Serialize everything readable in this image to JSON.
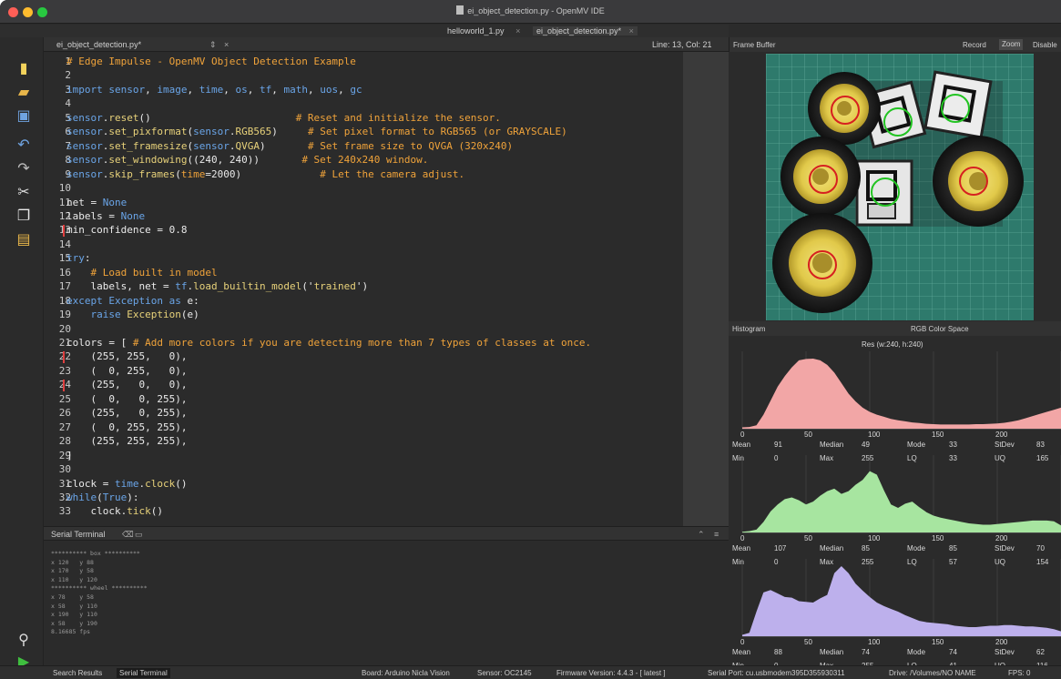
{
  "window": {
    "title": "ei_object_detection.py - OpenMV IDE"
  },
  "tabs": [
    {
      "label": "helloworld_1.py"
    },
    {
      "label": "ei_object_detection.py*"
    }
  ],
  "editor": {
    "file": "ei_object_detection.py*",
    "position": "Line: 13, Col: 21",
    "lines": [
      {
        "n": "1",
        "segs": [
          [
            "c",
            "# Edge Impulse - OpenMV Object Detection Example"
          ]
        ]
      },
      {
        "n": "2",
        "segs": []
      },
      {
        "n": "3",
        "segs": [
          [
            "k",
            "import "
          ],
          [
            "f",
            "sensor"
          ],
          [
            "n",
            ", "
          ],
          [
            "f",
            "image"
          ],
          [
            "n",
            ", "
          ],
          [
            "f",
            "time"
          ],
          [
            "n",
            ", "
          ],
          [
            "f",
            "os"
          ],
          [
            "n",
            ", "
          ],
          [
            "f",
            "tf"
          ],
          [
            "n",
            ", "
          ],
          [
            "f",
            "math"
          ],
          [
            "n",
            ", "
          ],
          [
            "f",
            "uos"
          ],
          [
            "n",
            ", "
          ],
          [
            "f",
            "gc"
          ]
        ]
      },
      {
        "n": "4",
        "segs": []
      },
      {
        "n": "5",
        "segs": [
          [
            "f",
            "sensor"
          ],
          [
            "n",
            "."
          ],
          [
            "s",
            "reset"
          ],
          [
            "n",
            "()                        "
          ],
          [
            "c",
            "# Reset and initialize the sensor."
          ]
        ]
      },
      {
        "n": "6",
        "segs": [
          [
            "f",
            "sensor"
          ],
          [
            "n",
            "."
          ],
          [
            "s",
            "set_pixformat"
          ],
          [
            "n",
            "("
          ],
          [
            "f",
            "sensor"
          ],
          [
            "n",
            "."
          ],
          [
            "s",
            "RGB565"
          ],
          [
            "n",
            ")     "
          ],
          [
            "c",
            "# Set pixel format to RGB565 (or GRAYSCALE)"
          ]
        ]
      },
      {
        "n": "7",
        "segs": [
          [
            "f",
            "sensor"
          ],
          [
            "n",
            "."
          ],
          [
            "s",
            "set_framesize"
          ],
          [
            "n",
            "("
          ],
          [
            "f",
            "sensor"
          ],
          [
            "n",
            "."
          ],
          [
            "s",
            "QVGA"
          ],
          [
            "n",
            ")       "
          ],
          [
            "c",
            "# Set frame size to QVGA (320x240)"
          ]
        ]
      },
      {
        "n": "8",
        "segs": [
          [
            "f",
            "sensor"
          ],
          [
            "n",
            "."
          ],
          [
            "s",
            "set_windowing"
          ],
          [
            "n",
            "((240, 240))       "
          ],
          [
            "c",
            "# Set 240x240 window."
          ]
        ]
      },
      {
        "n": "9",
        "segs": [
          [
            "f",
            "sensor"
          ],
          [
            "n",
            "."
          ],
          [
            "s",
            "skip_frames"
          ],
          [
            "n",
            "("
          ],
          [
            "m",
            "time"
          ],
          [
            "n",
            "=2000)             "
          ],
          [
            "c",
            "# Let the camera adjust."
          ]
        ]
      },
      {
        "n": "10",
        "segs": []
      },
      {
        "n": "11",
        "segs": [
          [
            "n",
            "net = "
          ],
          [
            "k",
            "None"
          ]
        ]
      },
      {
        "n": "12",
        "segs": [
          [
            "n",
            "labels = "
          ],
          [
            "k",
            "None"
          ]
        ]
      },
      {
        "n": "13",
        "segs": [
          [
            "n",
            "min_confidence = 0.8"
          ]
        ]
      },
      {
        "n": "14",
        "segs": []
      },
      {
        "n": "15",
        "segs": [
          [
            "k",
            "try"
          ],
          [
            "n",
            ":"
          ]
        ]
      },
      {
        "n": "16",
        "segs": [
          [
            "n",
            "    "
          ],
          [
            "c",
            "# Load built in model"
          ]
        ]
      },
      {
        "n": "17",
        "segs": [
          [
            "n",
            "    labels, net = "
          ],
          [
            "f",
            "tf"
          ],
          [
            "n",
            "."
          ],
          [
            "s",
            "load_builtin_model"
          ],
          [
            "n",
            "('"
          ],
          [
            "s",
            "trained"
          ],
          [
            "n",
            "')"
          ]
        ]
      },
      {
        "n": "18",
        "segs": [
          [
            "k",
            "except "
          ],
          [
            "f",
            "Exception "
          ],
          [
            "k",
            "as "
          ],
          [
            "n",
            "e:"
          ]
        ]
      },
      {
        "n": "19",
        "segs": [
          [
            "n",
            "    "
          ],
          [
            "k",
            "raise "
          ],
          [
            "s",
            "Exception"
          ],
          [
            "n",
            "(e)"
          ]
        ]
      },
      {
        "n": "20",
        "segs": []
      },
      {
        "n": "21",
        "segs": [
          [
            "n",
            "colors = [ "
          ],
          [
            "c",
            "# Add more colors if you are detecting more than 7 types of classes at once."
          ]
        ]
      },
      {
        "n": "22",
        "segs": [
          [
            "n",
            "    (255, 255,   0),"
          ]
        ]
      },
      {
        "n": "23",
        "segs": [
          [
            "n",
            "    (  0, 255,   0),"
          ]
        ]
      },
      {
        "n": "24",
        "segs": [
          [
            "n",
            "    (255,   0,   0),"
          ]
        ]
      },
      {
        "n": "25",
        "segs": [
          [
            "n",
            "    (  0,   0, 255),"
          ]
        ]
      },
      {
        "n": "26",
        "segs": [
          [
            "n",
            "    (255,   0, 255),"
          ]
        ]
      },
      {
        "n": "27",
        "segs": [
          [
            "n",
            "    (  0, 255, 255),"
          ]
        ]
      },
      {
        "n": "28",
        "segs": [
          [
            "n",
            "    (255, 255, 255),"
          ]
        ]
      },
      {
        "n": "29",
        "segs": [
          [
            "n",
            "]"
          ]
        ]
      },
      {
        "n": "30",
        "segs": []
      },
      {
        "n": "31",
        "segs": [
          [
            "n",
            "clock = "
          ],
          [
            "f",
            "time"
          ],
          [
            "n",
            "."
          ],
          [
            "s",
            "clock"
          ],
          [
            "n",
            "()"
          ]
        ]
      },
      {
        "n": "32",
        "segs": [
          [
            "k",
            "while"
          ],
          [
            "n",
            "("
          ],
          [
            "k",
            "True"
          ],
          [
            "n",
            "):"
          ]
        ]
      },
      {
        "n": "33",
        "segs": [
          [
            "n",
            "    clock."
          ],
          [
            "s",
            "tick"
          ],
          [
            "n",
            "()"
          ]
        ]
      }
    ]
  },
  "terminal": {
    "tab_serial": "Serial Terminal",
    "lines": [
      "********** box **********",
      "x 120   y 88",
      "x 170   y 58",
      "x 110   y 120",
      "********** wheel **********",
      "x 78    y 58",
      "x 58    y 110",
      "x 190   y 110",
      "x 58    y 190",
      "8.16685 fps"
    ]
  },
  "framebuffer": {
    "title": "Frame Buffer",
    "record": "Record",
    "zoom": "Zoom",
    "disable": "Disable"
  },
  "histogram": {
    "title": "Histogram",
    "colorspace": "RGB Color Space",
    "resolution": "Res (w:240, h:240)",
    "axis_ticks": [
      "0",
      "50",
      "100",
      "150",
      "200"
    ],
    "stat_labels": [
      "Mean",
      "Median",
      "Mode",
      "StDev",
      "Min",
      "Max",
      "LQ",
      "UQ"
    ],
    "channels": [
      {
        "color": "#f2a6a6",
        "mean": "91",
        "median": "49",
        "mode": "33",
        "stdev": "83",
        "min": "0",
        "max": "255",
        "lq": "33",
        "uq": "165",
        "curve": [
          4,
          5,
          10,
          40,
          80,
          120,
          150,
          175,
          195,
          199,
          200,
          195,
          182,
          160,
          130,
          100,
          78,
          60,
          48,
          40,
          34,
          28,
          24,
          21,
          18,
          16,
          14,
          13,
          12,
          12,
          12,
          12,
          12,
          13,
          13,
          14,
          15,
          17,
          20,
          24,
          30,
          36,
          42,
          48,
          54,
          60
        ]
      },
      {
        "color": "#a7e5a0",
        "mean": "107",
        "median": "85",
        "mode": "85",
        "stdev": "70",
        "min": "0",
        "max": "255",
        "lq": "57",
        "uq": "154",
        "curve": [
          2,
          4,
          8,
          30,
          60,
          80,
          95,
          100,
          92,
          80,
          88,
          105,
          118,
          125,
          110,
          118,
          136,
          150,
          175,
          165,
          120,
          80,
          70,
          82,
          88,
          72,
          58,
          48,
          42,
          38,
          34,
          30,
          26,
          24,
          22,
          22,
          24,
          26,
          28,
          30,
          32,
          34,
          34,
          34,
          32,
          20
        ]
      },
      {
        "color": "#bdb0ec",
        "mean": "88",
        "median": "74",
        "mode": "74",
        "stdev": "62",
        "min": "0",
        "max": "255",
        "lq": "41",
        "uq": "116",
        "curve": [
          4,
          10,
          70,
          125,
          132,
          122,
          112,
          110,
          100,
          98,
          96,
          108,
          118,
          180,
          200,
          180,
          150,
          130,
          112,
          96,
          86,
          78,
          70,
          60,
          52,
          44,
          40,
          38,
          36,
          34,
          30,
          28,
          26,
          26,
          28,
          30,
          30,
          32,
          32,
          30,
          28,
          28,
          26,
          24,
          20,
          14
        ]
      }
    ]
  },
  "bottombar": {
    "search_results": "Search Results",
    "serial_terminal": "Serial Terminal",
    "board": "Board: Arduino Nicla Vision",
    "sensor": "Sensor: OC2145",
    "firmware": "Firmware Version: 4.4.3 - [ latest ]",
    "serial_port": "Serial Port: cu.usbmodem395D355930311",
    "drive": "Drive: /Volumes/NO NAME",
    "fps": "FPS: 0"
  },
  "icons": [
    "new-file-icon",
    "open-folder-icon",
    "save-icon",
    "undo-icon",
    "redo-icon",
    "cut-icon",
    "copy-icon",
    "paste-icon",
    "connect-icon",
    "run-icon"
  ]
}
